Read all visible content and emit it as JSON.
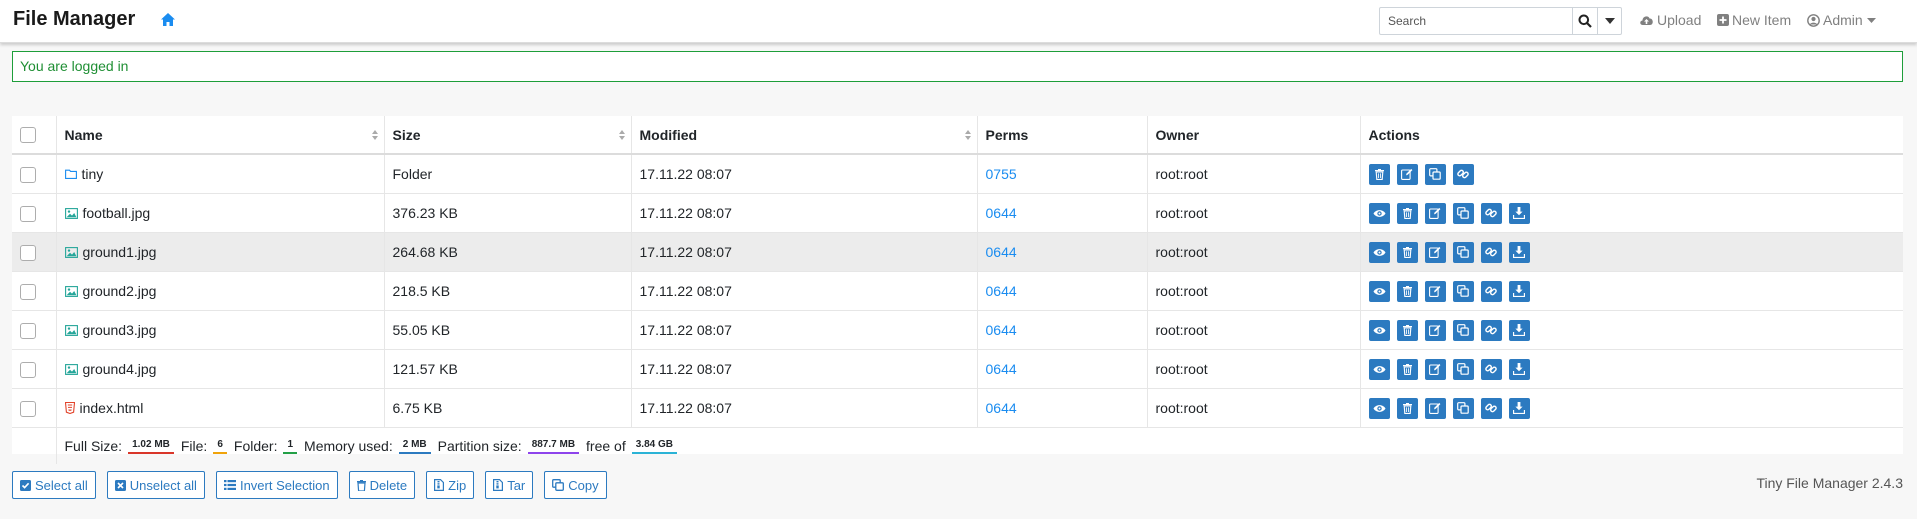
{
  "navbar": {
    "brand": "File Manager",
    "search_placeholder": "Search",
    "upload_label": "Upload",
    "new_item_label": "New Item",
    "user_label": "Admin"
  },
  "alert": {
    "message": "You are logged in"
  },
  "table": {
    "headers": {
      "name": "Name",
      "size": "Size",
      "modified": "Modified",
      "perms": "Perms",
      "owner": "Owner",
      "actions": "Actions"
    },
    "rows": [
      {
        "name": "tiny",
        "type": "folder",
        "size": "Folder",
        "modified": "17.11.22 08:07",
        "perms": "0755",
        "owner": "root:root"
      },
      {
        "name": "football.jpg",
        "type": "image",
        "size": "376.23 KB",
        "modified": "17.11.22 08:07",
        "perms": "0644",
        "owner": "root:root"
      },
      {
        "name": "ground1.jpg",
        "type": "image",
        "size": "264.68 KB",
        "modified": "17.11.22 08:07",
        "perms": "0644",
        "owner": "root:root"
      },
      {
        "name": "ground2.jpg",
        "type": "image",
        "size": "218.5 KB",
        "modified": "17.11.22 08:07",
        "perms": "0644",
        "owner": "root:root"
      },
      {
        "name": "ground3.jpg",
        "type": "image",
        "size": "55.05 KB",
        "modified": "17.11.22 08:07",
        "perms": "0644",
        "owner": "root:root"
      },
      {
        "name": "ground4.jpg",
        "type": "image",
        "size": "121.57 KB",
        "modified": "17.11.22 08:07",
        "perms": "0644",
        "owner": "root:root"
      },
      {
        "name": "index.html",
        "type": "html",
        "size": "6.75 KB",
        "modified": "17.11.22 08:07",
        "perms": "0644",
        "owner": "root:root"
      }
    ],
    "footer": {
      "full_size_label": "Full Size:",
      "full_size": "1.02 MB",
      "file_label": "File:",
      "file_count": "6",
      "folder_label": "Folder:",
      "folder_count": "1",
      "memory_label": "Memory used:",
      "memory": "2 MB",
      "partition_label": "Partition size:",
      "partition": "887.7 MB",
      "free_of_label": "free of",
      "total": "3.84 GB"
    }
  },
  "buttons": {
    "select_all": "Select all",
    "unselect_all": "Unselect all",
    "invert": "Invert Selection",
    "delete": "Delete",
    "zip": "Zip",
    "tar": "Tar",
    "copy": "Copy"
  },
  "version": "Tiny File Manager 2.4.3",
  "colors": {
    "accent": "#2c7ac0",
    "link": "#1a8cf0",
    "alert_green": "#1e9e3a",
    "badge_full_size": "#d9362a",
    "badge_file": "#f0a30a",
    "badge_folder": "#23a047",
    "badge_memory": "#2c7ac0",
    "badge_partition": "#8e44ec",
    "badge_total": "#2bb3d6"
  }
}
